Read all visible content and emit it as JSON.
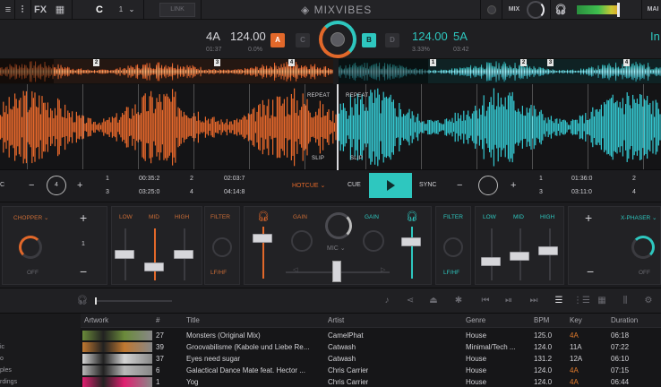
{
  "topbar": {
    "fx_label": "FX",
    "deck_number": "1",
    "link_label": "LINK",
    "logo": "MIXVIBES",
    "mix_label": "MIX",
    "main_label": "MAI"
  },
  "deck_left": {
    "key": "4A",
    "bpm": "124.00",
    "time": "01:37",
    "pitch": "0.0%"
  },
  "deck_right": {
    "key": "5A",
    "bpm": "124.00",
    "time": "03:42",
    "pitch": "3.33%",
    "label_r": "In"
  },
  "deck_select": {
    "a": "A",
    "c": "C",
    "b": "B",
    "d": "D"
  },
  "overview": {
    "left_marks": [
      "2",
      "3",
      "4"
    ],
    "right_marks": [
      "1",
      "2",
      "3",
      "4"
    ]
  },
  "waveform": {
    "repeat": "REPEAT",
    "slip": "SLIP"
  },
  "transport": {
    "beat_count": "4",
    "left_cues": [
      {
        "n": "1",
        "t": "00:35:2"
      },
      {
        "n": "2",
        "t": "02:03:7"
      },
      {
        "n": "3",
        "t": "03:25:0"
      },
      {
        "n": "4",
        "t": "04:14:8"
      }
    ],
    "hotcue": "HOTCUE",
    "cue": "CUE",
    "sync": "SYNC",
    "right_cues": [
      {
        "n": "1",
        "t": "01:36:0"
      },
      {
        "n": "2",
        "t": ""
      },
      {
        "n": "3",
        "t": "03:11:0"
      },
      {
        "n": "4",
        "t": ""
      }
    ]
  },
  "mixer": {
    "left_fx": "CHOPPER",
    "right_fx": "X-PHASER",
    "fx_value": "1",
    "off": "OFF",
    "low": "LOW",
    "mid": "MID",
    "high": "HIGH",
    "filter": "FILTER",
    "lfhf": "LF/HF",
    "gain": "GAIN",
    "mic": "MIC"
  },
  "browser": {
    "side_items": [
      "ic",
      "o",
      "ples",
      "rdings"
    ],
    "headers": {
      "artwork": "Artwork",
      "num": "#",
      "title": "Title",
      "artist": "Artist",
      "genre": "Genre",
      "bpm": "BPM",
      "key": "Key",
      "duration": "Duration"
    },
    "tracks": [
      {
        "num": "27",
        "title": "Monsters (Original Mix)",
        "artist": "CamelPhat",
        "genre": "House",
        "bpm": "125.0",
        "key": "4A",
        "duration": "06:18",
        "art": "#6a8a3a"
      },
      {
        "num": "39",
        "title": "Groovabilisme (Kabole und Liebe Re...",
        "artist": "Catwash",
        "genre": "Minimal/Tech ...",
        "bpm": "124.0",
        "key": "11A",
        "duration": "07:22",
        "art": "#c07830"
      },
      {
        "num": "37",
        "title": "Eyes need sugar",
        "artist": "Catwash",
        "genre": "House",
        "bpm": "131.2",
        "key": "12A",
        "duration": "06:10",
        "art": "#d4d4d4"
      },
      {
        "num": "6",
        "title": "Galactical Dance Mate feat. Hector ...",
        "artist": "Chris Carrier",
        "genre": "House",
        "bpm": "124.0",
        "key": "4A",
        "duration": "07:15",
        "art": "#b8b8b8"
      },
      {
        "num": "1",
        "title": "Yog",
        "artist": "Chris Carrier",
        "genre": "House",
        "bpm": "124.0",
        "key": "4A",
        "duration": "06:44",
        "art": "#e02070"
      }
    ]
  },
  "colors": {
    "orange": "#e2682a",
    "teal": "#2ec7bf"
  }
}
